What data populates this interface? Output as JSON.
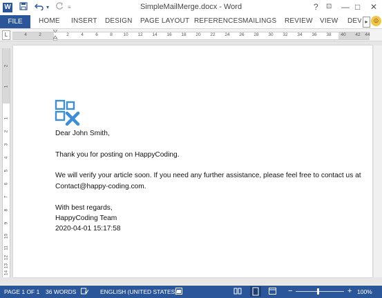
{
  "window": {
    "title": "SimpleMailMerge.docx - Word",
    "app_icon_label": "W",
    "controls": {
      "help": "?",
      "minimize": "—",
      "restore": "□",
      "close": "✕"
    }
  },
  "quick_access": {
    "save_icon": "save-icon",
    "undo_icon": "undo-icon",
    "redo_icon": "redo-icon"
  },
  "ribbon": {
    "file": "FILE",
    "tabs": [
      "HOME",
      "INSERT",
      "DESIGN",
      "PAGE LAYOUT",
      "REFERENCES",
      "MAILINGS",
      "REVIEW",
      "VIEW",
      "DEVE"
    ],
    "more_arrow": "▸"
  },
  "ruler": {
    "corner": "L",
    "h_labels": [
      "4",
      "2",
      "2",
      "4",
      "6",
      "8",
      "10",
      "12",
      "14",
      "16",
      "18",
      "20",
      "22",
      "24",
      "26",
      "28",
      "30",
      "32",
      "34",
      "36",
      "38",
      "40",
      "42",
      "44"
    ],
    "v_labels": [
      "2",
      "1",
      "1",
      "2",
      "3",
      "4",
      "5",
      "6",
      "7",
      "8",
      "9",
      "10",
      "11",
      "12",
      "13",
      "14",
      "15",
      "16"
    ]
  },
  "document": {
    "greeting": "Dear John Smith,",
    "line1": "Thank you for posting on HappyCoding.",
    "line2": "We will verify your article soon. If you need any further assistance, please feel free to contact us at",
    "line3": "Contact@happy-coding.com.",
    "closing": "With best regards,",
    "signature": "HappyCoding Team",
    "timestamp": "2020-04-01 15:17:58"
  },
  "status": {
    "page": "PAGE 1 OF 1",
    "words": "36 WORDS",
    "language": "ENGLISH (UNITED STATES)",
    "zoom": "100%",
    "zoom_minus": "−",
    "zoom_plus": "+"
  },
  "colors": {
    "accent": "#2b579a",
    "logo_blue": "#3a8fd8"
  }
}
